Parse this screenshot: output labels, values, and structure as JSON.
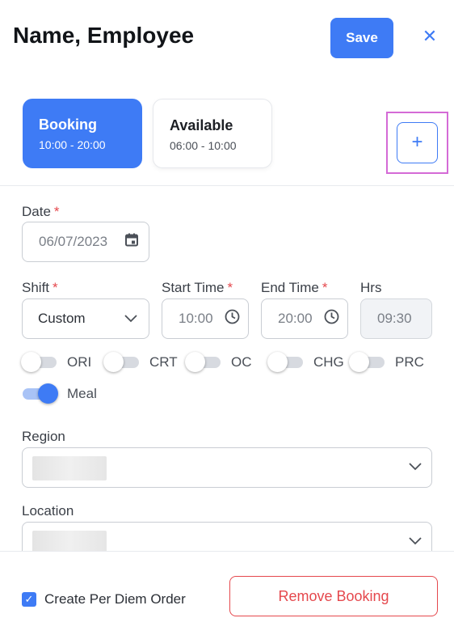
{
  "header": {
    "title": "Name, Employee",
    "save_label": "Save",
    "close_glyph": "✕"
  },
  "tabs": [
    {
      "label": "Booking",
      "time": "10:00 - 20:00",
      "active": true
    },
    {
      "label": "Available",
      "time": "06:00 - 10:00",
      "active": false
    }
  ],
  "add_button": {
    "glyph": "+"
  },
  "form": {
    "date": {
      "label": "Date",
      "required": "*",
      "value": "06/07/2023",
      "icon": "calendar-icon"
    },
    "shift": {
      "label": "Shift",
      "required": "*",
      "value": "Custom",
      "icon": "chevron-down-icon"
    },
    "start_time": {
      "label": "Start Time",
      "required": "*",
      "value": "10:00",
      "icon": "clock-icon"
    },
    "end_time": {
      "label": "End Time",
      "required": "*",
      "value": "20:00",
      "icon": "clock-icon"
    },
    "hrs": {
      "label": "Hrs",
      "value": "09:30"
    },
    "toggles": [
      {
        "label": "ORI",
        "on": false
      },
      {
        "label": "CRT",
        "on": false
      },
      {
        "label": "OC",
        "on": false
      },
      {
        "label": "CHG",
        "on": false
      },
      {
        "label": "PRC",
        "on": false
      },
      {
        "label": "Meal",
        "on": true
      }
    ],
    "region": {
      "label": "Region",
      "icon": "chevron-down-icon"
    },
    "location": {
      "label": "Location",
      "icon": "chevron-down-icon"
    }
  },
  "footer": {
    "checkbox_label": "Create Per Diem Order",
    "checkbox_checked": true,
    "remove_label": "Remove Booking"
  },
  "colors": {
    "accent": "#3e7bf5",
    "danger": "#e5484d",
    "highlight": "#d46ad6"
  }
}
